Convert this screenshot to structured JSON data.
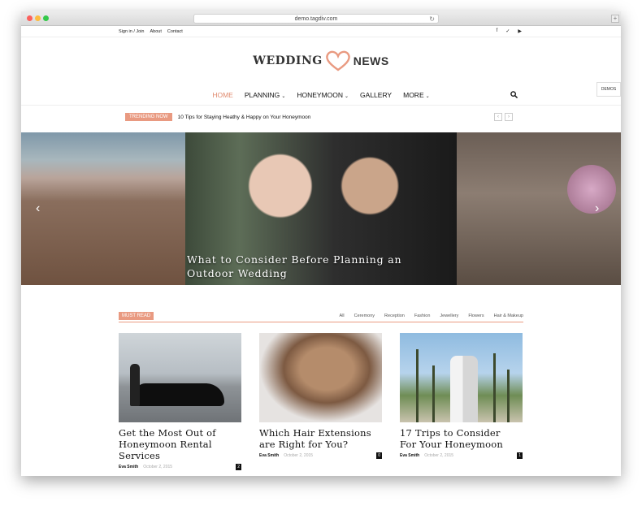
{
  "browser": {
    "url": "demo.tagdiv.com"
  },
  "topbar": {
    "links": [
      "Sign in / Join",
      "About",
      "Contact"
    ],
    "social_icons": [
      "facebook-icon",
      "twitter-icon",
      "youtube-icon"
    ]
  },
  "logo": {
    "left": "WEDDING",
    "right": "NEWS",
    "heart_color": "#e99a81"
  },
  "nav": {
    "items": [
      {
        "label": "HOME",
        "dropdown": false,
        "active": true
      },
      {
        "label": "PLANNING",
        "dropdown": true,
        "active": false
      },
      {
        "label": "HONEYMOON",
        "dropdown": true,
        "active": false
      },
      {
        "label": "GALLERY",
        "dropdown": false,
        "active": false
      },
      {
        "label": "MORE",
        "dropdown": true,
        "active": false
      }
    ],
    "accent_color": "#e08a6e"
  },
  "demos_label": "DEMOS",
  "trending": {
    "badge": "TRENDING NOW",
    "headline": "10 Tips for Staying Heathy & Happy on Your Honeymoon"
  },
  "slider": {
    "caption_line1": "What to Consider Before Planning an",
    "caption_line2": "Outdoor Wedding"
  },
  "must_read": {
    "badge": "MUST READ",
    "filters": [
      "All",
      "Ceremony",
      "Reception",
      "Fashion",
      "Jewellery",
      "Flowers",
      "Hair & Makeup"
    ]
  },
  "cards": [
    {
      "title_l1": "Get the Most Out of",
      "title_l2": "Honeymoon Rental",
      "title_l3": "Services",
      "author": "Eva Smith",
      "date": "October 2, 2015",
      "comments": "2"
    },
    {
      "title_l1": "Which Hair Extensions",
      "title_l2": "are Right for You?",
      "title_l3": "",
      "author": "Eva Smith",
      "date": "October 2, 2015",
      "comments": "0"
    },
    {
      "title_l1": "17 Trips to Consider",
      "title_l2": "For Your Honeymoon",
      "title_l3": "",
      "author": "Eva Smith",
      "date": "October 2, 2015",
      "comments": "1"
    }
  ]
}
